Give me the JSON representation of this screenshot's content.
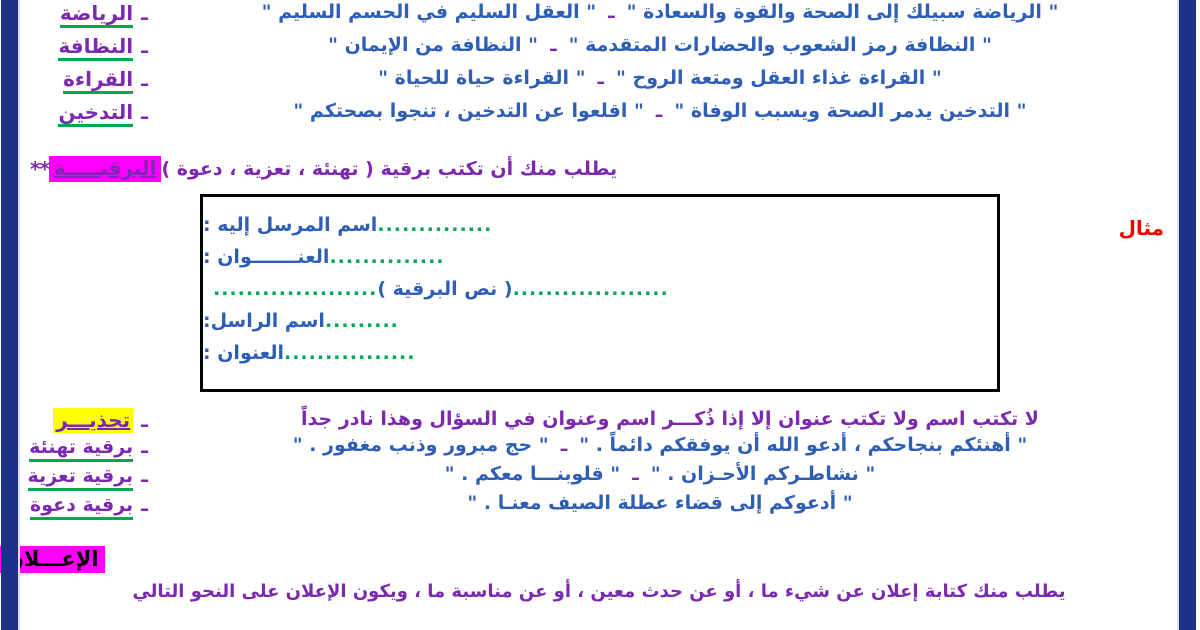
{
  "document": {
    "language": "ar",
    "colors": {
      "body_blue": "#2f5fb5",
      "term_purple": "#7c29b0",
      "underline_green": "#00a94f",
      "example_red": "#ee0000",
      "highlight_magenta": "#ff00ff",
      "highlight_yellow": "#ffff00",
      "side_bar_navy": "#1c3288",
      "box_border": "#000000"
    }
  },
  "maxims": {
    "rows": [
      {
        "term": "الرياضة",
        "dash": "ـ",
        "quote_right": "\" الرياضة سبيلك إلى الصحة  والقوة والسعادة  \"",
        "separator": "ـ",
        "quote_left": "\" العقل السليم في الحسم السليم \""
      },
      {
        "term": "النظافة",
        "dash": "ـ",
        "quote_right": "\" النظافة رمز الشعوب  والحضارات المتقدمة  \"",
        "separator": "ـ",
        "quote_left": "\" النظافة من الإيمان  \""
      },
      {
        "term": "القراءة",
        "dash": "ـ",
        "quote_right": "\" القراءة  غذاء العقل ومتعة الروح  \"",
        "separator": "ـ",
        "quote_left": "\" القراءة حياة للحياة  \""
      },
      {
        "term": "التدخين",
        "dash": "ـ",
        "quote_right": "\" التدخين يدمر الصحة ويسبب الوفاة  \"",
        "separator": "ـ",
        "quote_left": "\" اقلعوا عن التدخين ، تنجوا بصحتكم \""
      }
    ]
  },
  "telegram_section": {
    "stars": "**",
    "heading": "البرقيـــــة",
    "description": "يطلب منك أن تكتب برقية  ( تهنئة   ،   تعزية  ، دعوة )"
  },
  "example": {
    "label": "مثال",
    "lines": {
      "recipient_label": "اسم المرسل إليه  :",
      "recipient_dots": "..............",
      "address_label": "العنـــــــوان :",
      "address_dots": "..............",
      "body_label": "( نص البرقية )",
      "body_dots_right": "....................",
      "body_dots_left": "...................",
      "sender_label": "اسم الراسل:",
      "sender_dots": ".........",
      "sender_address_label": "العنوان :",
      "sender_address_dots": "................"
    }
  },
  "warning": {
    "dash": "ـ",
    "label": "تحذيـــر",
    "text": "لا تكتب اسم ولا تكتب عنوان إلا إذا ذُكـــر اسم وعنوان في السؤال وهذا نادر جداً"
  },
  "telegram_types": {
    "rows": [
      {
        "term": "برقية تهنئة",
        "dash": "ـ",
        "quote_right": "\" أهنئكم بنجاحكم ، أدعو الله أن يوفقكم دائماً .  \"",
        "separator": "ـ",
        "quote_left": "\" حج مبرور وذنب مغفور .  \""
      },
      {
        "term": "برقية تعزية",
        "dash": "ـ",
        "quote_right": "\" نشاطـركم الأحـزان .  \"",
        "separator": "ـ",
        "quote_left": "\" قلوبنـــا معكم .  \""
      },
      {
        "term": "برقية دعوة",
        "dash": "ـ",
        "quote_right": "\" أدعوكم إلى قضاء عطلة الصيف معنـا .  \"",
        "separator": "",
        "quote_left": ""
      }
    ]
  },
  "advertisement": {
    "heading": "الإعـــلان",
    "body": "يطلب منك كتابة إعلان عن شيء ما ، أو عن حدث معين ، أو عن مناسبة ما ، ويكون الإعلان على النحو التالي"
  }
}
